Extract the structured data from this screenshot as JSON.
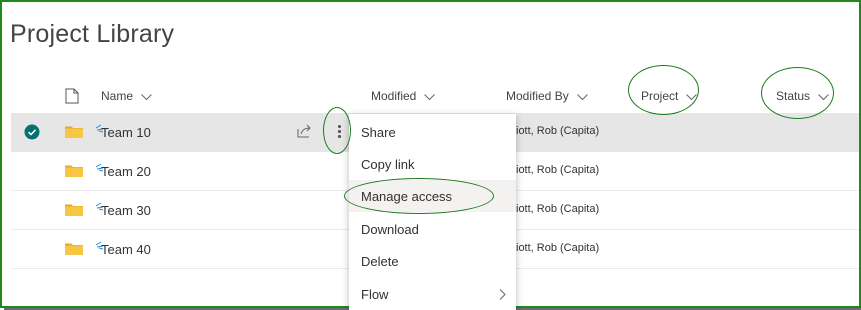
{
  "page_title": "Project Library",
  "columns": {
    "name": "Name",
    "modified": "Modified",
    "modified_by": "Modified By",
    "project": "Project",
    "status": "Status"
  },
  "rows": [
    {
      "name": "Team 10",
      "modified_by": "iott, Rob (Capita)",
      "selected": true
    },
    {
      "name": "Team 20",
      "modified_by": "iott, Rob (Capita)"
    },
    {
      "name": "Team 30",
      "modified_by": "iott, Rob (Capita)"
    },
    {
      "name": "Team 40",
      "modified_by": "iott, Rob (Capita)"
    }
  ],
  "context_menu": {
    "items": [
      {
        "label": "Share"
      },
      {
        "label": "Copy link"
      },
      {
        "label": "Manage access",
        "highlighted": true
      },
      {
        "label": "Download"
      },
      {
        "label": "Delete"
      },
      {
        "label": "Flow",
        "has_submenu": true
      }
    ]
  },
  "icons": {
    "file_header": "document-icon",
    "check": "checkmark-circle-icon",
    "folder": "folder-icon",
    "share": "share-icon",
    "more": "more-vertical-icon",
    "submenu": "chevron-right-icon"
  },
  "colors": {
    "annotation_green": "#1f7a1f",
    "folder_yellow": "#f6c644",
    "check_teal": "#04716f",
    "selected_row": "#e6e6e6"
  }
}
